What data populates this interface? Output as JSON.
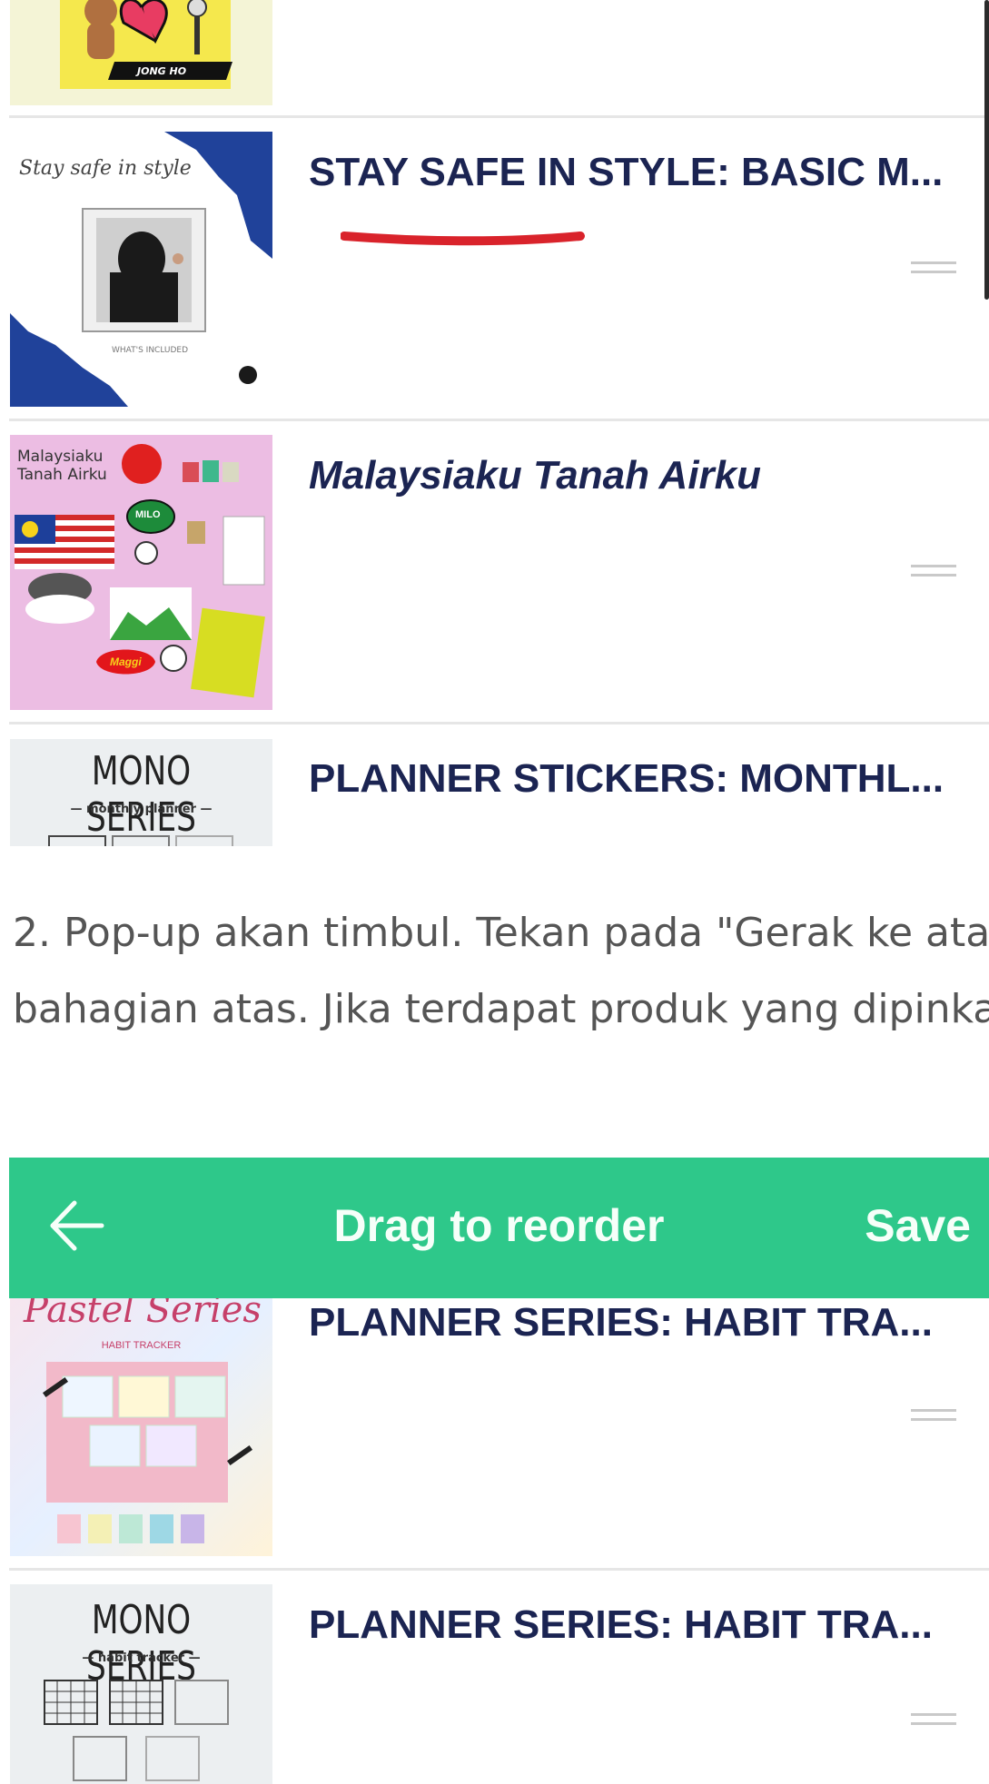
{
  "products": [
    {
      "title": "STAY SAFE IN STYLE: BASIC M...",
      "thumb_text": "Stay safe in style",
      "thumb_sub": "WHAT'S INCLUDED"
    },
    {
      "title": "Malaysiaku Tanah Airku",
      "thumb_text_1": "Malaysiaku",
      "thumb_text_2": "Tanah Airku",
      "milo": "MILO",
      "maggi": "Maggi"
    },
    {
      "title": "PLANNER STICKERS: MONTHL...",
      "thumb_text": "MONO SERIES",
      "thumb_sub": "— monthly planner —"
    }
  ],
  "top_thumb_label": "JONG HO",
  "instruction": {
    "line1": "2. Pop-up akan timbul. Tekan pada \"Gerak ke ata",
    "line2": "bahagian atas. Jika terdapat produk yang dipinka"
  },
  "reorder_bar": {
    "title": "Drag to reorder",
    "save_label": "Save",
    "back_icon": "arrow-left-icon",
    "color": "#2ec88a"
  },
  "reorder_items": [
    {
      "title": "PLANNER SERIES: HABIT TRA...",
      "thumb_text": "Pastel Series",
      "thumb_sub": "HABIT TRACKER"
    },
    {
      "title": "PLANNER SERIES: HABIT TRA...",
      "thumb_text": "MONO SERIES",
      "thumb_sub": "— habit tracker —"
    }
  ]
}
